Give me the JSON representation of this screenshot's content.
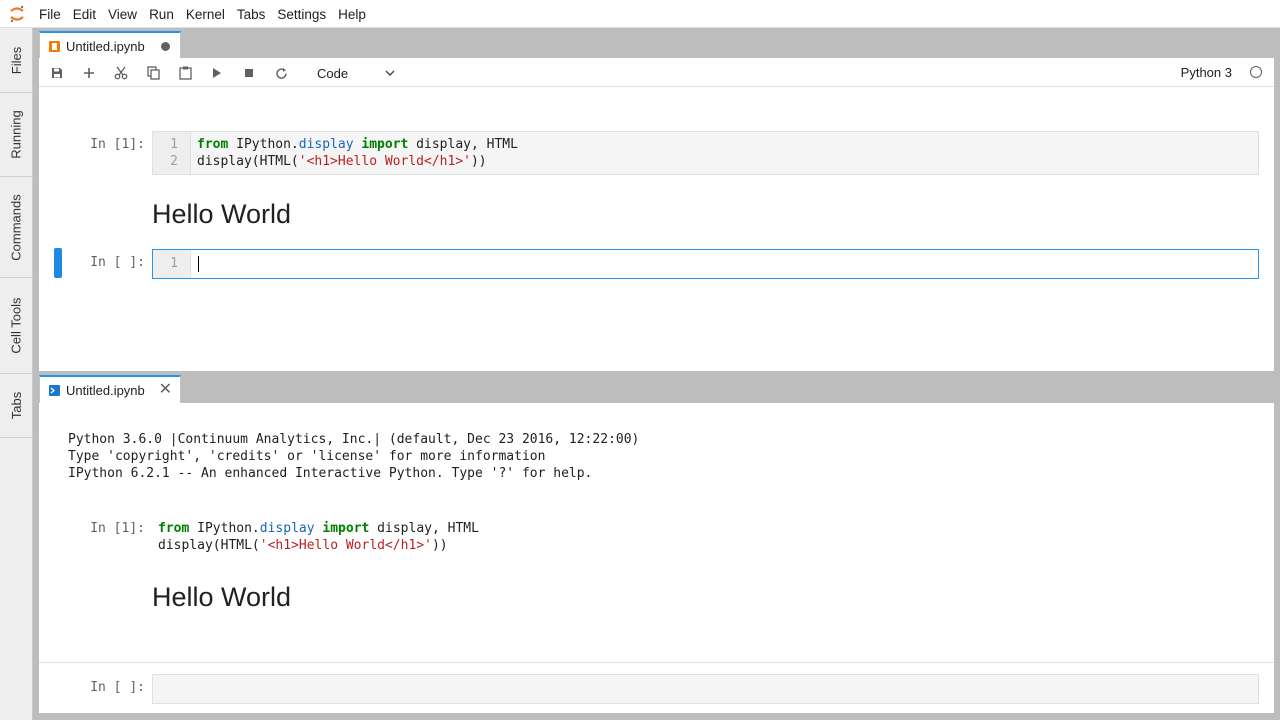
{
  "menubar": {
    "items": [
      "File",
      "Edit",
      "View",
      "Run",
      "Kernel",
      "Tabs",
      "Settings",
      "Help"
    ]
  },
  "sidebar": {
    "tabs": [
      "Files",
      "Running",
      "Commands",
      "Cell Tools",
      "Tabs"
    ]
  },
  "notebook": {
    "tab_title": "Untitled.ipynb",
    "toolbar": {
      "cell_type": "Code",
      "kernel_name": "Python 3"
    },
    "cells": [
      {
        "prompt": "In [1]:",
        "line_numbers": [
          "1",
          "2"
        ],
        "lines": [
          [
            {
              "t": "from",
              "c": "kw"
            },
            {
              "t": " IPython."
            },
            {
              "t": "display",
              "c": "nm"
            },
            {
              "t": " "
            },
            {
              "t": "import",
              "c": "kw"
            },
            {
              "t": " display, HTML"
            }
          ],
          [
            {
              "t": "display(HTML("
            },
            {
              "t": "'<h1>Hello World</h1>'",
              "c": "st"
            },
            {
              "t": "))"
            }
          ]
        ],
        "output": "Hello World"
      },
      {
        "prompt": "In [ ]:",
        "line_numbers": [
          "1"
        ]
      }
    ]
  },
  "console": {
    "tab_title": "Untitled.ipynb",
    "banner": [
      "Python 3.6.0 |Continuum Analytics, Inc.| (default, Dec 23 2016, 12:22:00)",
      "Type 'copyright', 'credits' or 'license' for more information",
      "IPython 6.2.1 -- An enhanced Interactive Python. Type '?' for help."
    ],
    "executed": {
      "prompt": "In [1]:",
      "lines": [
        [
          {
            "t": "from",
            "c": "kw"
          },
          {
            "t": " IPython."
          },
          {
            "t": "display",
            "c": "nm"
          },
          {
            "t": " "
          },
          {
            "t": "import",
            "c": "kw"
          },
          {
            "t": " display, HTML"
          }
        ],
        [
          {
            "t": "display(HTML("
          },
          {
            "t": "'<h1>Hello World</h1>'",
            "c": "st"
          },
          {
            "t": "))"
          }
        ]
      ],
      "output": "Hello World"
    },
    "input_prompt": "In [ ]:"
  },
  "colors": {
    "accent": "#2196f3",
    "keyword": "#008000",
    "module": "#1565c0",
    "string": "#ba2121"
  }
}
